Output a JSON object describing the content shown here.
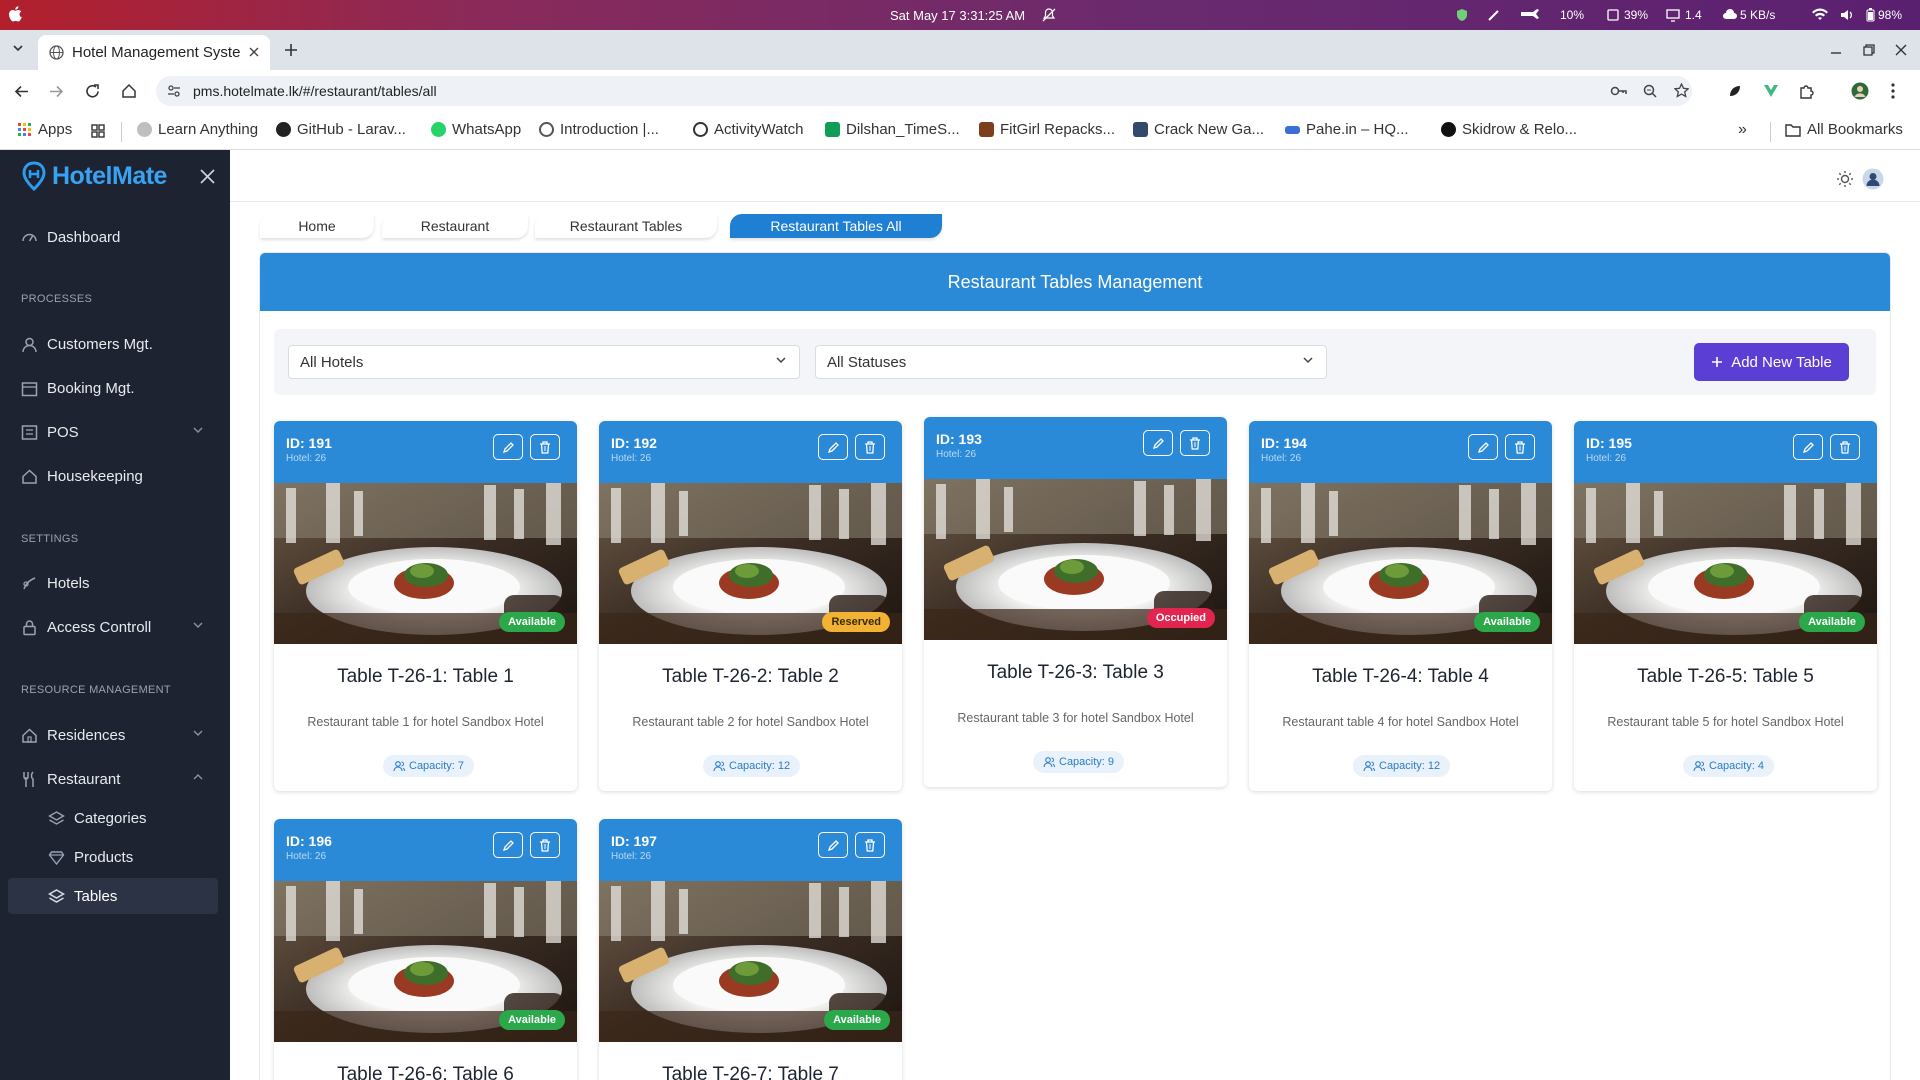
{
  "system_bar": {
    "datetime": "Sat May 17   3:31:25 AM",
    "battery_charge": "10%",
    "cpu": "39%",
    "load": "1.4",
    "net": "5 KB/s",
    "battery": "98%"
  },
  "browser": {
    "tab_title": "Hotel Management Syste",
    "url": "pms.hotelmate.lk/#/restaurant/tables/all",
    "bookmarks": [
      {
        "label": "Apps",
        "icon": "apps-grid-icon",
        "color": "#e8453c"
      },
      {
        "label": "Learn Anything",
        "icon": "learn-anything-icon",
        "color": "#8b8b8b"
      },
      {
        "label": "GitHub - Larav...",
        "icon": "github-icon",
        "color": "#222222"
      },
      {
        "label": "WhatsApp",
        "icon": "whatsapp-icon",
        "color": "#25d366"
      },
      {
        "label": "Introduction |...",
        "icon": "gear-icon",
        "color": "#555555"
      },
      {
        "label": "ActivityWatch",
        "icon": "activitywatch-icon",
        "color": "#333333"
      },
      {
        "label": "Dilshan_TimeS...",
        "icon": "sheets-icon",
        "color": "#0f9d58"
      },
      {
        "label": "FitGirl Repacks...",
        "icon": "fitgirl-icon",
        "color": "#7b3f1e"
      },
      {
        "label": "Crack New Ga...",
        "icon": "crack-games-icon",
        "color": "#334a6b"
      },
      {
        "label": "Pahe.in – HQ...",
        "icon": "pahe-icon",
        "color": "#3b6fd6"
      },
      {
        "label": "Skidrow & Relo...",
        "icon": "skidrow-icon",
        "color": "#8b1414"
      }
    ],
    "all_bookmarks": "All Bookmarks"
  },
  "sidebar": {
    "logo": "HotelMate",
    "items": [
      {
        "label": "Dashboard",
        "icon": "dashboard-icon"
      },
      {
        "section": "PROCESSES"
      },
      {
        "label": "Customers Mgt.",
        "icon": "user-icon"
      },
      {
        "label": "Booking Mgt.",
        "icon": "calendar-icon"
      },
      {
        "label": "POS",
        "icon": "pos-icon"
      },
      {
        "label": "Housekeeping",
        "icon": "home-icon"
      },
      {
        "section": "SETTINGS"
      },
      {
        "label": "Hotels",
        "icon": "hotel-icon"
      },
      {
        "label": "Access Controll",
        "icon": "lock-icon"
      },
      {
        "section": "RESOURCE MANAGEMENT"
      },
      {
        "label": "Residences",
        "icon": "residence-icon"
      },
      {
        "label": "Restaurant",
        "icon": "utensils-icon"
      },
      {
        "label": "Categories",
        "icon": "layers-icon"
      },
      {
        "label": "Products",
        "icon": "products-icon"
      },
      {
        "label": "Tables",
        "icon": "tables-icon"
      }
    ]
  },
  "breadcrumbs": [
    "Home",
    "Restaurant",
    "Restaurant Tables",
    "Restaurant Tables All"
  ],
  "panel": {
    "title": "Restaurant Tables Management",
    "hotel_filter": "All Hotels",
    "status_filter": "All Statuses",
    "add_button": "Add New Table"
  },
  "status_colors": {
    "Available": "#2aa84a",
    "Reserved": "#f2b233",
    "Occupied": "#e2254e"
  },
  "tables": [
    {
      "id": "ID: 191",
      "hotel": "Hotel: 26",
      "status": "Available",
      "title": "Table T-26-1: Table 1",
      "desc": "Restaurant table 1 for hotel Sandbox Hotel",
      "capacity": "Capacity: 7"
    },
    {
      "id": "ID: 192",
      "hotel": "Hotel: 26",
      "status": "Reserved",
      "title": "Table T-26-2: Table 2",
      "desc": "Restaurant table 2 for hotel Sandbox Hotel",
      "capacity": "Capacity: 12"
    },
    {
      "id": "ID: 193",
      "hotel": "Hotel: 26",
      "status": "Occupied",
      "title": "Table T-26-3: Table 3",
      "desc": "Restaurant table 3 for hotel Sandbox Hotel",
      "capacity": "Capacity: 9"
    },
    {
      "id": "ID: 194",
      "hotel": "Hotel: 26",
      "status": "Available",
      "title": "Table T-26-4: Table 4",
      "desc": "Restaurant table 4 for hotel Sandbox Hotel",
      "capacity": "Capacity: 12"
    },
    {
      "id": "ID: 195",
      "hotel": "Hotel: 26",
      "status": "Available",
      "title": "Table T-26-5: Table 5",
      "desc": "Restaurant table 5 for hotel Sandbox Hotel",
      "capacity": "Capacity: 4"
    },
    {
      "id": "ID: 196",
      "hotel": "Hotel: 26",
      "status": "Available",
      "title": "Table T-26-6: Table 6",
      "desc": "",
      "capacity": ""
    },
    {
      "id": "ID: 197",
      "hotel": "Hotel: 26",
      "status": "Available",
      "title": "Table T-26-7: Table 7",
      "desc": "",
      "capacity": ""
    }
  ]
}
